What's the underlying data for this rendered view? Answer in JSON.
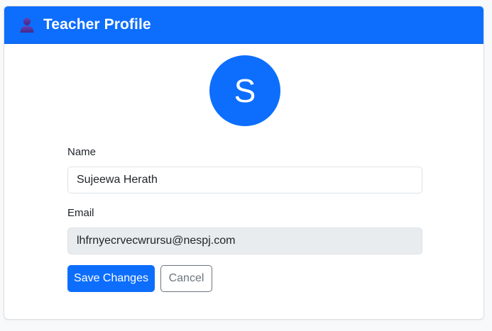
{
  "header": {
    "icon": "user-icon",
    "title": "Teacher Profile"
  },
  "avatar": {
    "initial": "S"
  },
  "form": {
    "name_label": "Name",
    "name_value": "Sujeewa Herath",
    "email_label": "Email",
    "email_value": "lhfrnyecrvecwrursu@nespj.com"
  },
  "actions": {
    "save_label": "Save Changes",
    "cancel_label": "Cancel"
  },
  "colors": {
    "primary": "#0d6efd",
    "secondary": "#6c757d",
    "readonly_bg": "#e9ecef"
  }
}
